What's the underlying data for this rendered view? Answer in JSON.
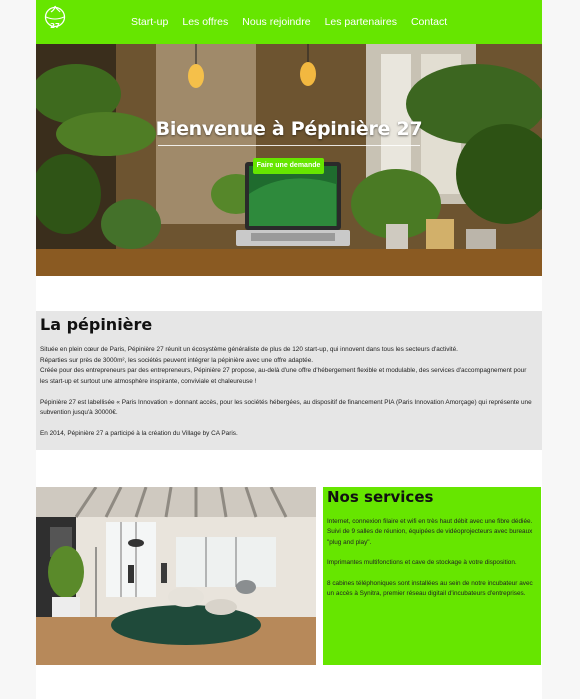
{
  "nav": {
    "items": [
      {
        "label": "Start-up"
      },
      {
        "label": "Les offres"
      },
      {
        "label": "Nous rejoindre"
      },
      {
        "label": "Les partenaires"
      },
      {
        "label": "Contact"
      }
    ],
    "logo_text": "27"
  },
  "hero": {
    "title": "Bienvenue à Pépinière 27",
    "button_label": "Faire une demande"
  },
  "pepiniere": {
    "title": "La pépinière",
    "paragraphs": [
      "Située en plein cœur de Paris, Pépinière 27 réunit un écosystème généraliste de plus de 120 start-up, qui innovent dans tous les secteurs d'activité.",
      "Réparties sur près de 3000m², les sociétés peuvent intégrer la pépinière avec une offre adaptée.",
      "Créée pour des entrepreneurs par des entrepreneurs, Pépinière 27 propose, au-delà d'une offre d'hébergement flexible et modulable, des services d'accompagnement pour les start-up et surtout une atmosphère inspirante, conviviale et chaleureuse !",
      "Pépinière 27 est labellisée « Paris Innovation » donnant accès, pour les sociétés hébergées, au dispositif de financement PIA (Paris Innovation Amorçage) qui représente une subvention jusqu'à 30000€.",
      "En 2014, Pépinière 27 a participé à la création du Village by CA Paris."
    ]
  },
  "services": {
    "title": "Nos services",
    "paragraphs": [
      "Internet, connexion filaire et wifi en très haut débit avec une fibre dédiée. Suivi de 9 salles de réunion, équipées de vidéoprojecteurs avec bureaux \"plug and play\".",
      "Imprimantes multifonctions et cave de stockage à votre disposition.",
      "8 cabines téléphoniques sont installées au sein de notre incubateur avec un accès à Synitra, premier réseau digitail d'incubateurs d'entreprises."
    ]
  },
  "colors": {
    "accent": "#66e600",
    "section_gray": "#e6e6e6"
  }
}
